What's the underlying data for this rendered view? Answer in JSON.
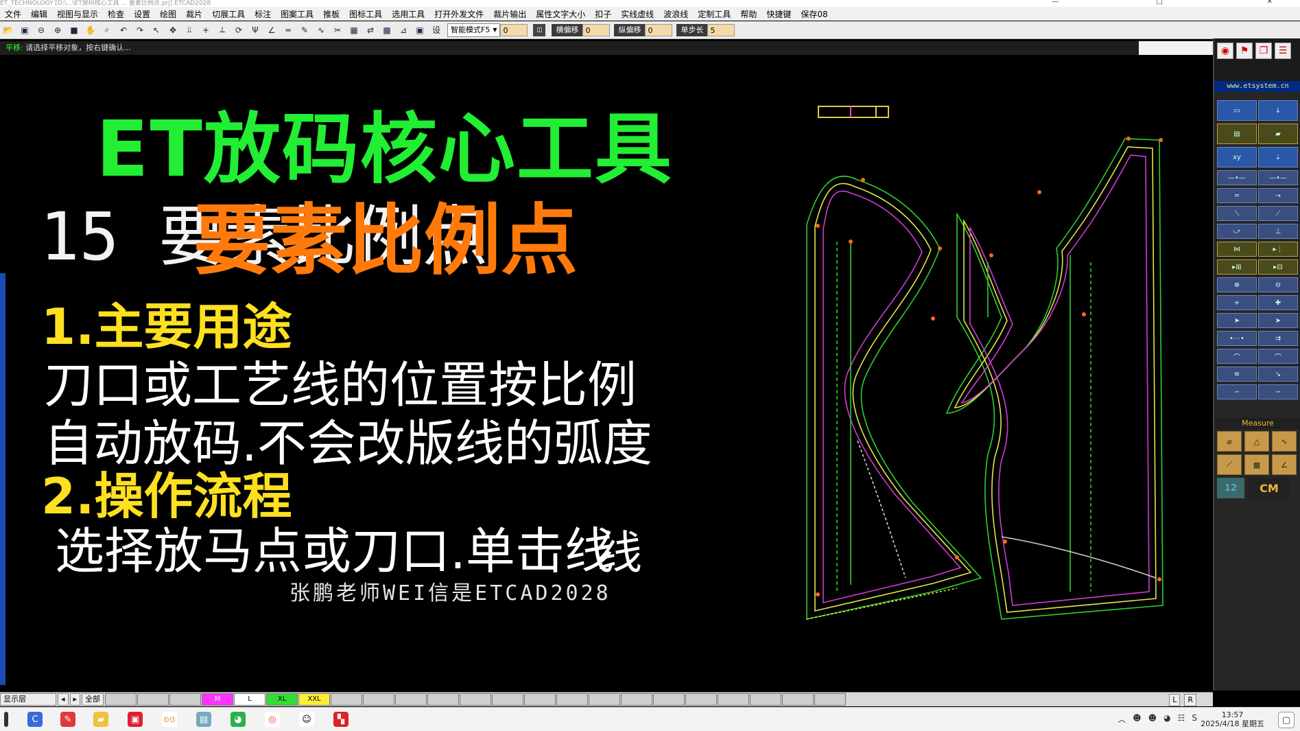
{
  "window": {
    "title": "ET_TECHNOLOGY   [D:\\...\\ET放码核心工具 ... 要素比例点.prj]   ETCAD2028",
    "controls": [
      "—",
      "□",
      "✕"
    ]
  },
  "menu": [
    "文件",
    "编辑",
    "视图与显示",
    "检查",
    "设置",
    "绘图",
    "裁片",
    "切展工具",
    "标注",
    "图案工具",
    "推板",
    "图标工具",
    "选用工具",
    "打开外发文件",
    "裁片输出",
    "属性文字大小",
    "扣子",
    "实线虚线",
    "波浪线",
    "定制工具",
    "帮助",
    "快捷键",
    "保存08"
  ],
  "toolbar": {
    "mode": "智能模式F5",
    "value1": "0",
    "h_offset_label": "横偏移",
    "h_offset": "0",
    "v_offset_label": "纵偏移",
    "v_offset": "0",
    "step_label": "单步长",
    "step": "5",
    "settings_label": "设"
  },
  "prompt": {
    "key": "平移:",
    "text": "请选择平移对象，按右键确认..."
  },
  "canvas": {
    "title_line1": "ET放码核心工具",
    "ghost_text": "15 要素比例点",
    "title_line2": "要素比例点",
    "heading1": "1.主要用途",
    "line1": "刀口或工艺线的位置按比例",
    "line2": "自动放码.不会改版线的弧度",
    "heading2": "2.操作流程",
    "line3": "选择放马点或刀口.单击线",
    "ghost_text2": "线",
    "signature": "张鹏老师WEI信是ETCAD2028"
  },
  "right_panel": {
    "url": "www.etsystem.cn",
    "measure_label": "Measure",
    "unit_left": "12",
    "unit_right": "CM"
  },
  "layer_bar": {
    "label": "显示层",
    "all_label": "全部",
    "sizes": [
      "M",
      "L",
      "XL",
      "XXL"
    ],
    "size_colors": [
      "#ff33ff",
      "#ffffff",
      "#33dd33",
      "#ffee33"
    ],
    "left_right": [
      "L",
      "R"
    ]
  },
  "taskbar": {
    "time": "13:57",
    "date": "2025/4/18 星期五"
  }
}
